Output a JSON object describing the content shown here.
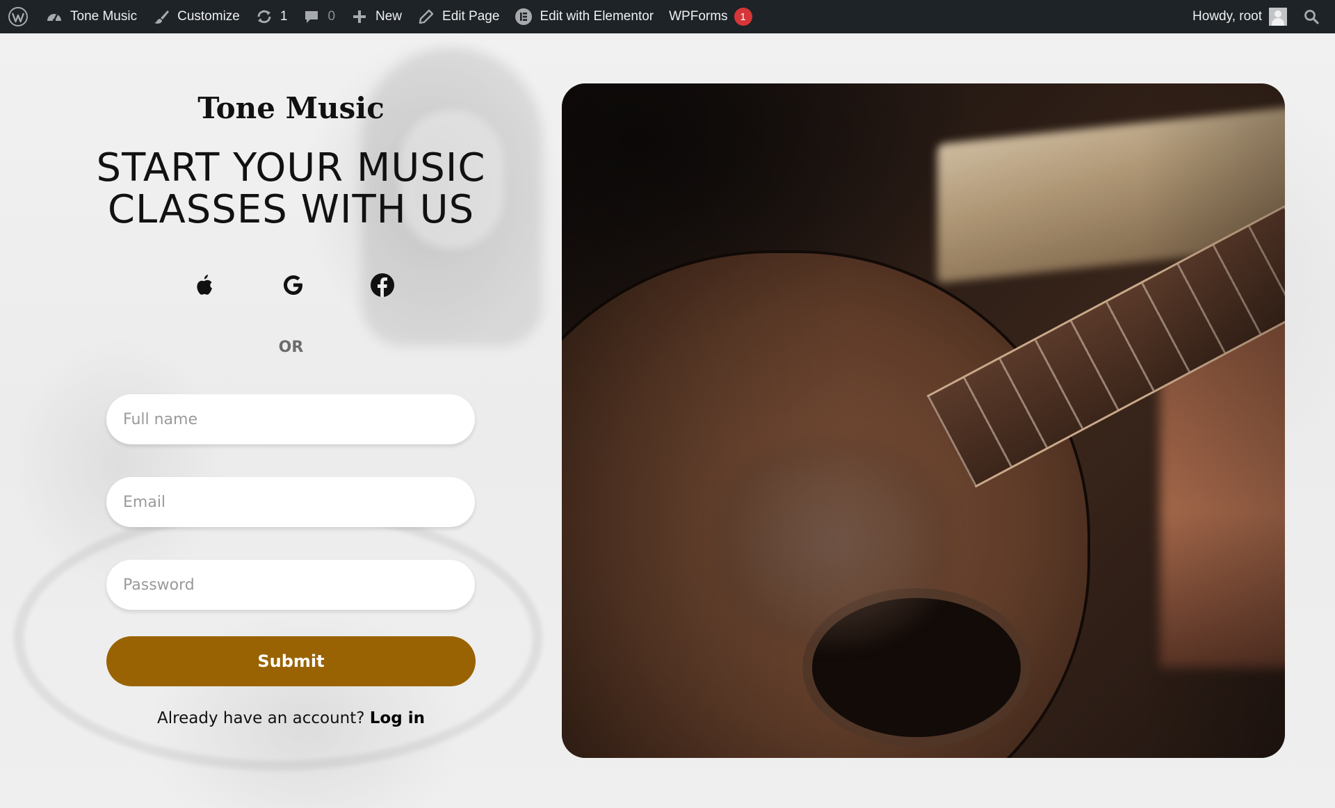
{
  "adminbar": {
    "site_name": "Tone Music",
    "customize": "Customize",
    "updates_count": "1",
    "comments_count": "0",
    "new": "New",
    "edit_page": "Edit Page",
    "edit_elementor": "Edit with Elementor",
    "wpforms": "WPForms",
    "wpforms_badge": "1",
    "howdy": "Howdy, root"
  },
  "hero": {
    "brand": "Tone Music",
    "headline_line1": "START YOUR MUSIC",
    "headline_line2": "CLASSES WITH US",
    "socials": [
      "apple-icon",
      "google-icon",
      "facebook-icon"
    ],
    "divider": "OR"
  },
  "form": {
    "full_name_placeholder": "Full name",
    "email_placeholder": "Email",
    "password_placeholder": "Password",
    "submit_label": "Submit",
    "already_text": "Already have an account?",
    "login_label": "Log in"
  },
  "colors": {
    "adminbar_bg": "#1d2327",
    "submit_bg": "#996303",
    "badge_bg": "#d63638"
  }
}
